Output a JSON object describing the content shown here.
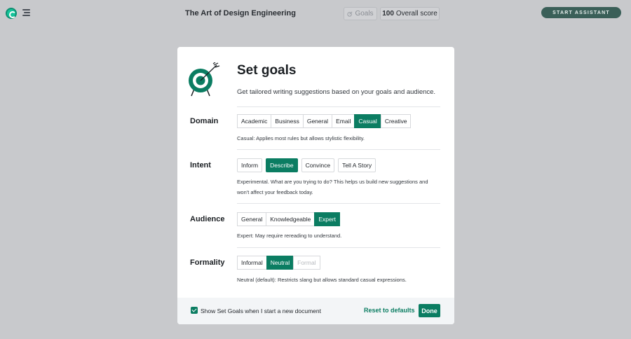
{
  "topbar": {
    "document_title": "The Art of Design Engineering",
    "goals_label": "Goals",
    "score_value": "100",
    "score_label": "Overall score",
    "assistant_label": "START ASSISTANT"
  },
  "modal": {
    "title": "Set goals",
    "subtitle": "Get tailored writing suggestions based on your goals and audience.",
    "sections": {
      "domain": {
        "label": "Domain",
        "options": [
          "Academic",
          "Business",
          "General",
          "Email",
          "Casual",
          "Creative"
        ],
        "selected": "Casual",
        "description": "Casual: Applies most rules but allows stylistic flexibility."
      },
      "intent": {
        "label": "Intent",
        "options": [
          "Inform",
          "Describe",
          "Convince",
          "Tell A Story"
        ],
        "selected": "Describe",
        "description": "Experimental. What are you trying to do? This helps us build new suggestions and won't affect your feedback today."
      },
      "audience": {
        "label": "Audience",
        "options": [
          "General",
          "Knowledgeable",
          "Expert"
        ],
        "selected": "Expert",
        "description": "Expert: May require rereading to understand."
      },
      "formality": {
        "label": "Formality",
        "options": [
          "Informal",
          "Neutral",
          "Formal"
        ],
        "selected": "Neutral",
        "disabled": [
          "Formal"
        ],
        "description": "Neutral (default): Restricts slang but allows standard casual expressions."
      }
    },
    "footer": {
      "checkbox_label": "Show Set Goals when I start a new document",
      "checkbox_checked": true,
      "reset_label": "Reset to defaults",
      "done_label": "Done"
    }
  },
  "colors": {
    "accent": "#0b7d62",
    "backdrop": "#c8c9cc",
    "assistant_button": "#3a5f58"
  },
  "icons": {
    "logo": "grammarly-logo-icon",
    "menu": "menu-icon",
    "goals": "goals-target-icon",
    "illustration": "target-arrow-icon"
  }
}
